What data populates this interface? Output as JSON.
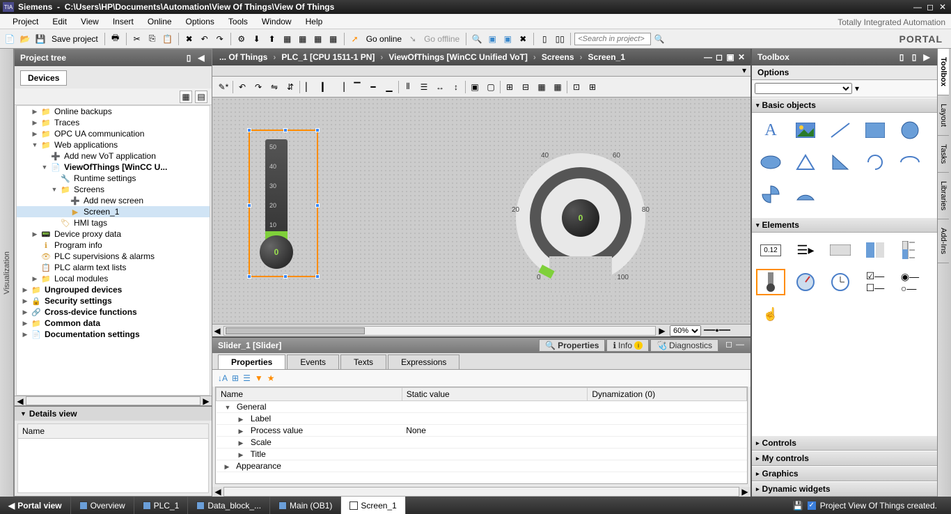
{
  "titlebar": {
    "app": "Siemens",
    "path": "C:\\Users\\HP\\Documents\\Automation\\View Of Things\\View Of Things"
  },
  "menu": [
    "Project",
    "Edit",
    "View",
    "Insert",
    "Online",
    "Options",
    "Tools",
    "Window",
    "Help"
  ],
  "brand": {
    "line1": "Totally Integrated Automation",
    "line2": "PORTAL"
  },
  "toolbar": {
    "save": "Save project",
    "goonline": "Go online",
    "gooffline": "Go offline",
    "search_placeholder": "<Search in project>"
  },
  "project_tree": {
    "title": "Project tree",
    "tab": "Devices",
    "items": [
      {
        "indent": 1,
        "arrow": "▶",
        "icon": "📁",
        "label": "Online backups"
      },
      {
        "indent": 1,
        "arrow": "▶",
        "icon": "📁",
        "label": "Traces"
      },
      {
        "indent": 1,
        "arrow": "▶",
        "icon": "📁",
        "label": "OPC UA communication"
      },
      {
        "indent": 1,
        "arrow": "▼",
        "icon": "📁",
        "label": "Web applications"
      },
      {
        "indent": 2,
        "arrow": "",
        "icon": "➕",
        "label": "Add new VoT application"
      },
      {
        "indent": 2,
        "arrow": "▼",
        "icon": "📄",
        "label": "ViewOfThings [WinCC U...",
        "bold": true
      },
      {
        "indent": 3,
        "arrow": "",
        "icon": "🔧",
        "label": "Runtime settings"
      },
      {
        "indent": 3,
        "arrow": "▼",
        "icon": "📁",
        "label": "Screens"
      },
      {
        "indent": 4,
        "arrow": "",
        "icon": "➕",
        "label": "Add new screen"
      },
      {
        "indent": 4,
        "arrow": "",
        "icon": "▶",
        "label": "Screen_1",
        "selected": true
      },
      {
        "indent": 3,
        "arrow": "",
        "icon": "🏷",
        "label": "HMI tags"
      },
      {
        "indent": 1,
        "arrow": "▶",
        "icon": "📟",
        "label": "Device proxy data"
      },
      {
        "indent": 1,
        "arrow": "",
        "icon": "ℹ",
        "label": "Program info"
      },
      {
        "indent": 1,
        "arrow": "",
        "icon": "👁",
        "label": "PLC supervisions & alarms"
      },
      {
        "indent": 1,
        "arrow": "",
        "icon": "📋",
        "label": "PLC alarm text lists"
      },
      {
        "indent": 1,
        "arrow": "▶",
        "icon": "📁",
        "label": "Local modules"
      },
      {
        "indent": 0,
        "arrow": "▶",
        "icon": "📁",
        "label": "Ungrouped devices",
        "bold": true
      },
      {
        "indent": 0,
        "arrow": "▶",
        "icon": "🔒",
        "label": "Security settings",
        "bold": true
      },
      {
        "indent": 0,
        "arrow": "▶",
        "icon": "🔗",
        "label": "Cross-device functions",
        "bold": true
      },
      {
        "indent": 0,
        "arrow": "▶",
        "icon": "📁",
        "label": "Common data",
        "bold": true
      },
      {
        "indent": 0,
        "arrow": "▶",
        "icon": "📄",
        "label": "Documentation settings",
        "bold": true
      }
    ]
  },
  "details": {
    "title": "Details view",
    "col": "Name"
  },
  "breadcrumb": [
    "... Of Things",
    "PLC_1 [CPU 1511-1 PN]",
    "ViewOfThings [WinCC Unified VoT]",
    "Screens",
    "Screen_1"
  ],
  "canvas": {
    "zoom": "60%",
    "slider": {
      "value": "0",
      "ticks": [
        "50",
        "40",
        "30",
        "20",
        "10"
      ]
    },
    "gauge": {
      "value": "0",
      "ticks": [
        "0",
        "20",
        "40",
        "60",
        "80",
        "100"
      ]
    }
  },
  "props": {
    "object": "Slider_1 [Slider]",
    "main_tabs": {
      "properties": "Properties",
      "info": "Info",
      "diagnostics": "Diagnostics"
    },
    "sub_tabs": [
      "Properties",
      "Events",
      "Texts",
      "Expressions"
    ],
    "grid_headers": [
      "Name",
      "Static value",
      "Dynamization (0)"
    ],
    "rows": [
      {
        "type": "group",
        "arrow": "▼",
        "name": "General"
      },
      {
        "type": "sub",
        "arrow": "▶",
        "name": "Label"
      },
      {
        "type": "sub",
        "arrow": "▶",
        "name": "Process value",
        "static": "None"
      },
      {
        "type": "sub",
        "arrow": "▶",
        "name": "Scale"
      },
      {
        "type": "sub",
        "arrow": "▶",
        "name": "Title"
      },
      {
        "type": "group",
        "arrow": "▶",
        "name": "Appearance"
      }
    ]
  },
  "toolbox": {
    "title": "Toolbox",
    "options": "Options",
    "sections": {
      "basic": "Basic objects",
      "elements": "Elements",
      "controls": "Controls",
      "mycontrols": "My controls",
      "graphics": "Graphics",
      "dynamic": "Dynamic widgets"
    }
  },
  "vtabs_right": [
    "Toolbox",
    "Layout",
    "Tasks",
    "Libraries",
    "Add-Ins"
  ],
  "vtab_left": "Visualization",
  "statusbar": {
    "portal": "Portal view",
    "tabs": [
      {
        "label": "Overview"
      },
      {
        "label": "PLC_1"
      },
      {
        "label": "Data_block_..."
      },
      {
        "label": "Main (OB1)"
      },
      {
        "label": "Screen_1",
        "active": true
      }
    ],
    "message": "Project View Of Things created."
  }
}
